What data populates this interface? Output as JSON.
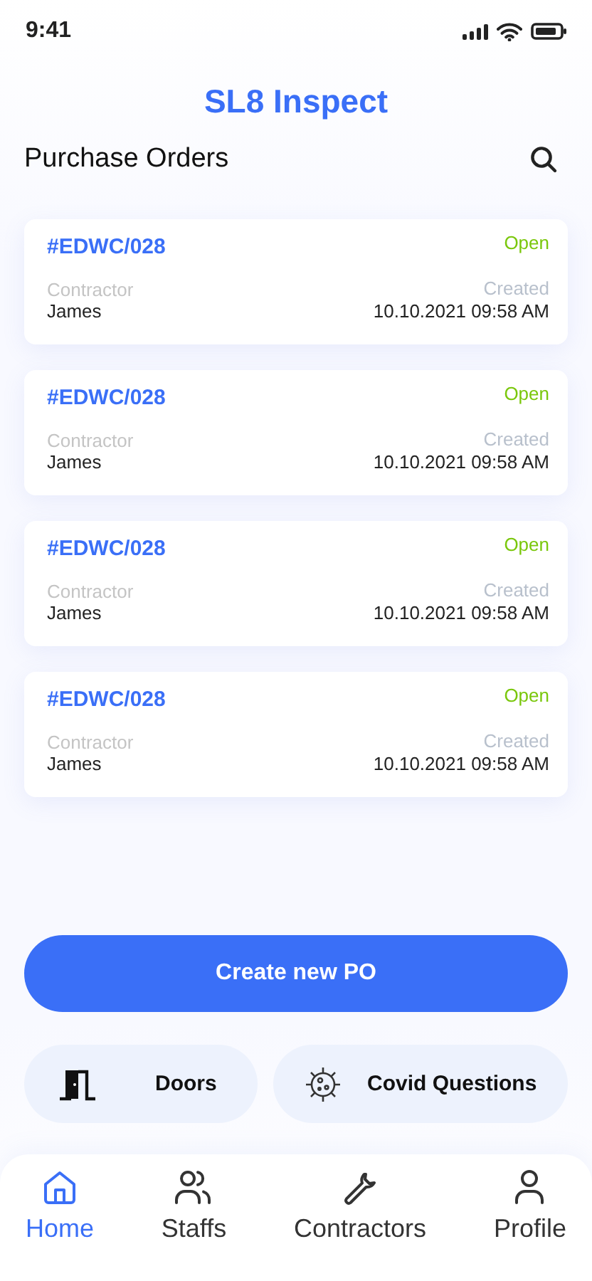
{
  "status_bar": {
    "time": "9:41"
  },
  "app_title": "SL8 Inspect",
  "page_title": "Purchase Orders",
  "orders": [
    {
      "number": "#EDWC/028",
      "status": "Open",
      "contractor_label": "Contractor",
      "contractor": "James",
      "created_label": "Created",
      "created": "10.10.2021 09:58 AM"
    },
    {
      "number": "#EDWC/028",
      "status": "Open",
      "contractor_label": "Contractor",
      "contractor": "James",
      "created_label": "Created",
      "created": "10.10.2021 09:58 AM"
    },
    {
      "number": "#EDWC/028",
      "status": "Open",
      "contractor_label": "Contractor",
      "contractor": "James",
      "created_label": "Created",
      "created": "10.10.2021 09:58 AM"
    },
    {
      "number": "#EDWC/028",
      "status": "Open",
      "contractor_label": "Contractor",
      "contractor": "James",
      "created_label": "Created",
      "created": "10.10.2021 09:58 AM"
    }
  ],
  "primary_button": "Create new PO",
  "shortcuts": [
    {
      "kind": "door",
      "label": "Doors"
    },
    {
      "kind": "virus",
      "label": "Covid Questions"
    }
  ],
  "nav": [
    {
      "kind": "home",
      "label": "Home",
      "selected": true
    },
    {
      "kind": "people",
      "label": "Staffs",
      "selected": false
    },
    {
      "kind": "wrench",
      "label": "Contractors",
      "selected": false
    },
    {
      "kind": "person",
      "label": "Profile",
      "selected": false
    }
  ]
}
